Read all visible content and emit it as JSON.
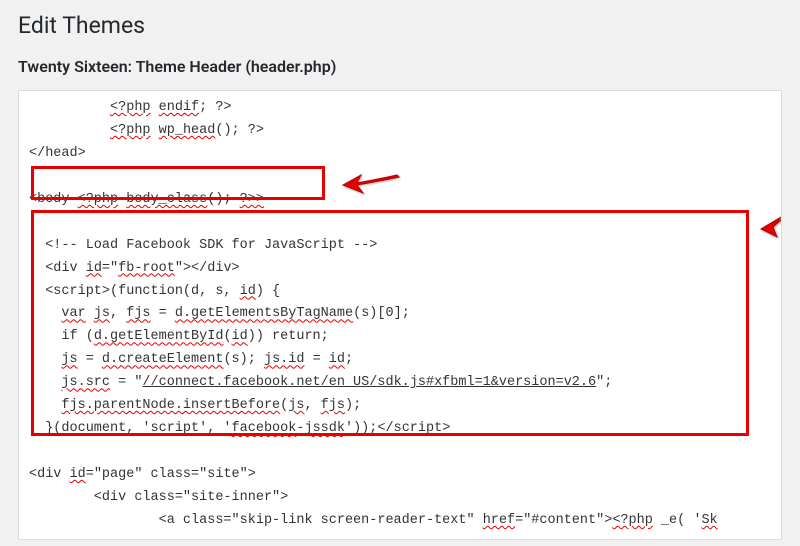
{
  "page_title": "Edit Themes",
  "file_title": "Twenty Sixteen: Theme Header (header.php)",
  "code": {
    "l1a": "          ",
    "l1b": "<?php",
    "l1c": " ",
    "l1d": "endif",
    "l1e": "; ?>",
    "l2a": "          ",
    "l2b": "<?php",
    "l2c": " ",
    "l2d": "wp_head",
    "l2e": "(); ?>",
    "l3": "</head>",
    "l4a": "<body ",
    "l4b": "<?php",
    "l4c": " ",
    "l4d": "body_class",
    "l4e": "(); ",
    "l4f": "?>>",
    "l5": "  <!-- Load Facebook SDK for JavaScript -->",
    "l6a": "  <div ",
    "l6b": "id",
    "l6c": "=\"",
    "l6d": "fb-root",
    "l6e": "\"></div>",
    "l7a": "  <script>(function(d, s, ",
    "l7b": "id",
    "l7c": ") {",
    "l8a": "    ",
    "l8b": "var",
    "l8c": " ",
    "l8d": "js",
    "l8e": ", ",
    "l8f": "fjs",
    "l8g": " = ",
    "l8h": "d.getElementsByTagName",
    "l8i": "(s)[0];",
    "l9a": "    if (",
    "l9b": "d.getElementById",
    "l9c": "(",
    "l9d": "id",
    "l9e": ")) return;",
    "l10a": "    ",
    "l10b": "js",
    "l10c": " = ",
    "l10d": "d.createElement",
    "l10e": "(s); ",
    "l10f": "js.id",
    "l10g": " = ",
    "l10h": "id",
    "l10i": ";",
    "l11a": "    ",
    "l11b": "js.src",
    "l11c": " = \"",
    "l11d": "//connect.facebook.net/en_US/sdk.js#xfbml=1&version=v2.6",
    "l11e": "\";",
    "l12a": "    ",
    "l12b": "fjs.parentNode.insertBefore",
    "l12c": "(",
    "l12d": "js",
    "l12e": ", ",
    "l12f": "fjs",
    "l12g": ");",
    "l13a": "  }(document, 'script', '",
    "l13b": "facebook",
    "l13c": "-",
    "l13d": "jssdk",
    "l13e": "'));</script>",
    "l14a": "<div ",
    "l14b": "id",
    "l14c": "=\"page\" class=\"site\">",
    "l15": "        <div class=\"site-inner\">",
    "l16a": "                <a class=\"skip-link screen-reader-text\" ",
    "l16b": "href",
    "l16c": "=\"#content\">",
    "l16d": "<?php",
    "l16e": " _e( '",
    "l16f": "Sk"
  }
}
